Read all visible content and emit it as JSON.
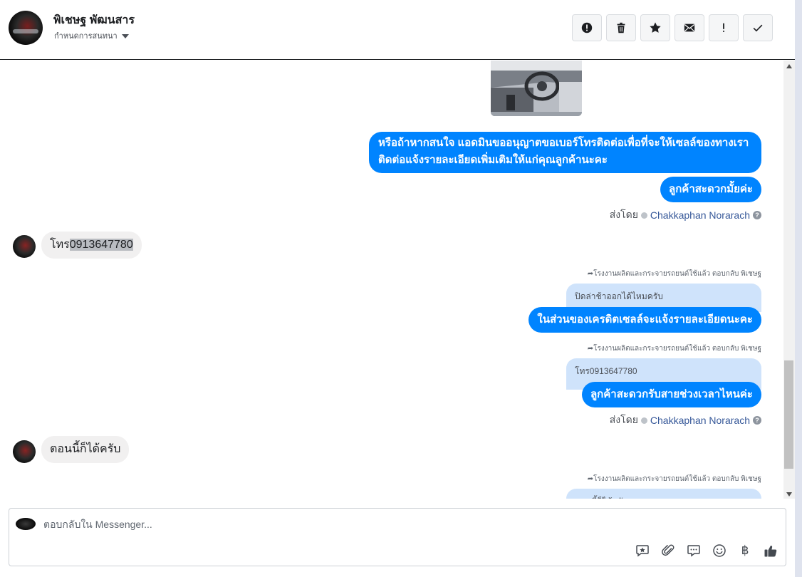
{
  "header": {
    "contact_name": "พิเชษฐ พัฒนสาร",
    "assign_label": "กำหนดการสนทนา",
    "toolbar": [
      {
        "name": "spam-icon"
      },
      {
        "name": "trash-icon"
      },
      {
        "name": "star-icon"
      },
      {
        "name": "envelope-icon"
      },
      {
        "name": "exclamation-icon"
      },
      {
        "name": "check-icon"
      }
    ]
  },
  "messages": {
    "out_1": "หรือถ้าหากสนใจ แอดมินขออนุญาตขอเบอร์โทรติดต่อเพื่อที่จะให้เซลล์ของทางเรา",
    "out_1b": "ติดต่อแจ้งรายละเอียดเพิ่มเติมให้แก่คุณลูกค้านะคะ",
    "out_2": "ลูกค้าสะดวกมั้ยค่ะ",
    "sent_by_prefix": "ส่งโดย",
    "agent_name": "Chakkaphan Norarach",
    "help_glyph": "?",
    "in_1_prefix": "โทร",
    "in_1_number": "0913647780",
    "reply_note_1": "โรงงานผลิตและกระจายรถยนต์ใช้แล้ว ตอบกลับ พิเชษฐ",
    "quote_1": "ปิดล่าช้าออกได้ไหมครับ",
    "out_3": "ในส่วนของเครดิตเซลล์จะแจ้งรายละเอียดนะคะ",
    "reply_note_2": "โรงงานผลิตและกระจายรถยนต์ใช้แล้ว ตอบกลับ พิเชษฐ",
    "quote_2": "โทร0913647780",
    "out_4": "ลูกค้าสะดวกรับสายช่วงเวลาไหนค่ะ",
    "in_2": "ตอนนี้ก็ได้ครับ",
    "reply_note_3": "โรงงานผลิตและกระจายรถยนต์ใช้แล้ว ตอบกลับ พิเชษฐ",
    "quote_3": "ตอนนี้ก็ได้ครับ"
  },
  "composer": {
    "placeholder": "ตอบกลับใน Messenger...",
    "baht_symbol": "฿",
    "actions": [
      "saved-reply-icon",
      "attachment-icon",
      "chat-bubble-icon",
      "emoji-icon",
      "baht-icon",
      "like-icon"
    ]
  },
  "colors": {
    "outgoing_bubble": "#0084ff",
    "incoming_bubble": "#f1f0f0",
    "quote_bubble": "#cfe3fb",
    "agent_link": "#365899"
  }
}
